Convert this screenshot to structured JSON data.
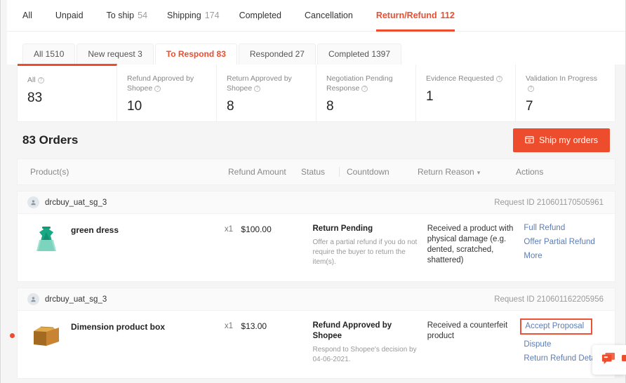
{
  "top_tabs": [
    {
      "label": "All",
      "count": ""
    },
    {
      "label": "Unpaid",
      "count": ""
    },
    {
      "label": "To ship",
      "count": "54"
    },
    {
      "label": "Shipping",
      "count": "174"
    },
    {
      "label": "Completed",
      "count": ""
    },
    {
      "label": "Cancellation",
      "count": ""
    },
    {
      "label": "Return/Refund",
      "count": "112",
      "active": true
    }
  ],
  "sub_tabs": [
    {
      "label": "All 1510"
    },
    {
      "label": "New request 3"
    },
    {
      "label": "To Respond 83",
      "active": true
    },
    {
      "label": "Responded 27"
    },
    {
      "label": "Completed 1397"
    }
  ],
  "stats": [
    {
      "label": "All",
      "value": "83",
      "has_info": true,
      "selected": true
    },
    {
      "label": "Refund Approved by Shopee",
      "value": "10",
      "has_info": true
    },
    {
      "label": "Return Approved by Shopee",
      "value": "8",
      "has_info": true
    },
    {
      "label": "Negotiation Pending Response",
      "value": "8",
      "has_info": true
    },
    {
      "label": "Evidence Requested",
      "value": "1",
      "has_info": true
    },
    {
      "label": "Validation In Progress",
      "value": "7",
      "has_info": true
    }
  ],
  "orders_header": {
    "title": "83 Orders",
    "ship_button": "Ship my orders",
    "ship_button_icon": "package-icon"
  },
  "table_headers": {
    "product": "Product(s)",
    "refund_amount": "Refund Amount",
    "status": "Status",
    "countdown": "Countdown",
    "return_reason": "Return Reason",
    "actions": "Actions"
  },
  "orders": [
    {
      "buyer": "drcbuy_uat_sg_3",
      "request_id": "Request ID 210601170505961",
      "product_name": "green dress",
      "product_image": "green-dress-thumbnail",
      "qty": "x1",
      "amount": "$100.00",
      "status_title": "Return Pending",
      "status_sub": "Offer a partial refund if you do not require the buyer to return the item(s).",
      "reason": "Received a product with physical damage (e.g. dented, scratched, shattered)",
      "actions": [
        {
          "label": "Full Refund"
        },
        {
          "label": "Offer Partial Refund"
        },
        {
          "label": "More"
        }
      ]
    },
    {
      "buyer": "drcbuy_uat_sg_3",
      "request_id": "Request ID 210601162205956",
      "product_name": "Dimension product box",
      "product_image": "cardboard-box-thumbnail",
      "qty": "x1",
      "amount": "$13.00",
      "status_title": "Refund Approved by Shopee",
      "status_sub": "Respond to Shopee's decision by 04-06-2021.",
      "reason": "Received a counterfeit product",
      "actions": [
        {
          "label": "Accept Proposal",
          "highlighted": true
        },
        {
          "label": "Dispute"
        },
        {
          "label": "Return Refund Details",
          "badge": true
        }
      ]
    }
  ],
  "chat_widget": {
    "icon": "chat-bubbles-icon"
  },
  "colors": {
    "accent": "#ee4d2d",
    "link": "#5b7cb8",
    "highlight_box": "#ef5136",
    "page_bg": "#f5f5f5"
  }
}
